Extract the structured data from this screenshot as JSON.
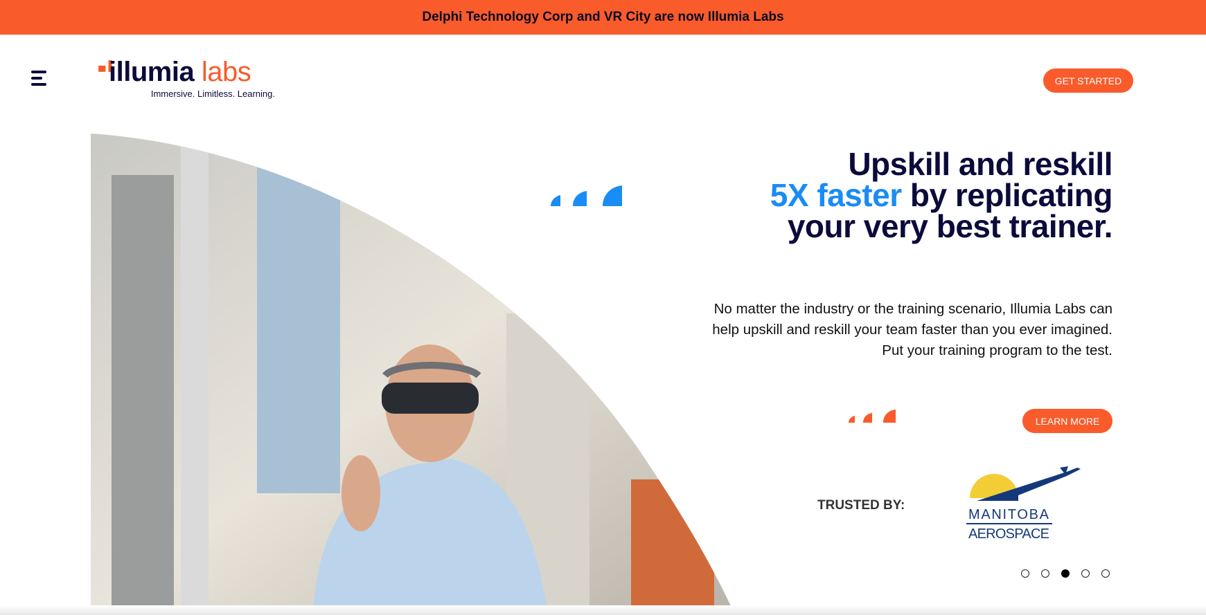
{
  "banner": {
    "text": "Delphi Technology Corp and VR City are now Illumia Labs"
  },
  "header": {
    "logo": {
      "word_main": "illumia",
      "word_accent": "labs",
      "tagline": "Immersive. Limitless. Learning."
    },
    "cta_label": "GET STARTED"
  },
  "hero": {
    "headline_line1": "Upskill and reskill",
    "headline_highlight": "5X faster",
    "headline_line2_rest": " by replicating",
    "headline_line3": "your very best trainer.",
    "paragraph": "No matter the industry or the training scenario, Illumia Labs can help upskill and reskill your team faster than you ever imagined. Put your training program to the test.",
    "learn_more_label": "LEARN MORE",
    "trusted_label": "TRUSTED BY:",
    "partner": {
      "line1": "MANITOBA",
      "line2": "AEROSPACE"
    }
  },
  "carousel": {
    "total": 5,
    "active_index": 2
  },
  "colors": {
    "brand_orange": "#f95b2b",
    "navy": "#0b0b3b",
    "accent_blue": "#1a8cf5"
  }
}
